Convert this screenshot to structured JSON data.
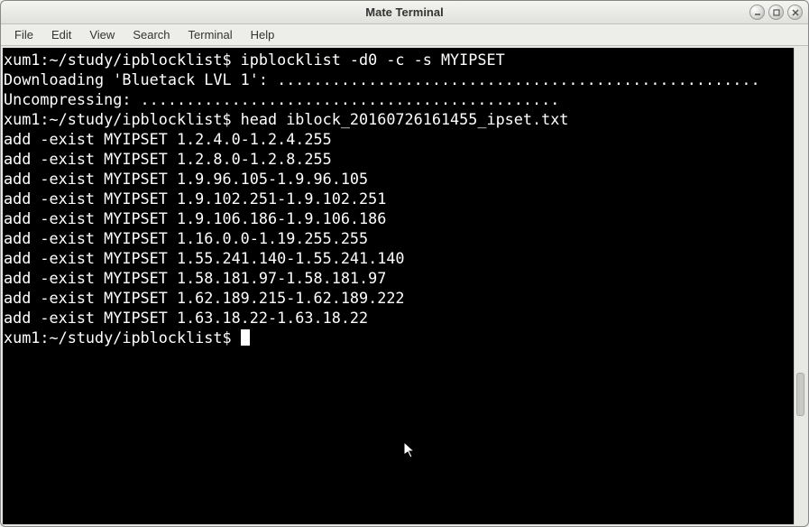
{
  "window": {
    "title": "Mate Terminal"
  },
  "menubar": {
    "items": [
      "File",
      "Edit",
      "View",
      "Search",
      "Terminal",
      "Help"
    ]
  },
  "terminal": {
    "prompt": "xum1:~/study/ipblocklist$",
    "lines": [
      "xum1:~/study/ipblocklist$ ipblocklist -d0 -c -s MYIPSET",
      "Downloading 'Bluetack LVL 1': .....................................................",
      "Uncompressing: ..............................................",
      "xum1:~/study/ipblocklist$ head iblock_20160726161455_ipset.txt",
      "add -exist MYIPSET 1.2.4.0-1.2.4.255",
      "add -exist MYIPSET 1.2.8.0-1.2.8.255",
      "add -exist MYIPSET 1.9.96.105-1.9.96.105",
      "add -exist MYIPSET 1.9.102.251-1.9.102.251",
      "add -exist MYIPSET 1.9.106.186-1.9.106.186",
      "add -exist MYIPSET 1.16.0.0-1.19.255.255",
      "add -exist MYIPSET 1.55.241.140-1.55.241.140",
      "add -exist MYIPSET 1.58.181.97-1.58.181.97",
      "add -exist MYIPSET 1.62.189.215-1.62.189.222",
      "add -exist MYIPSET 1.63.18.22-1.63.18.22"
    ],
    "final_prompt": "xum1:~/study/ipblocklist$ "
  }
}
